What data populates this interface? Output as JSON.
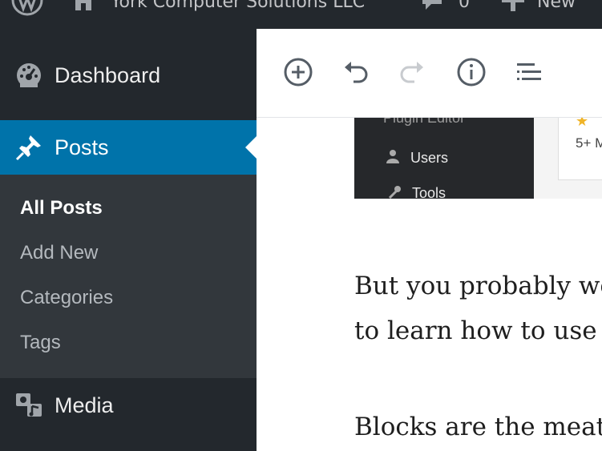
{
  "admin_bar": {
    "site_name": "York Computer Solutions LLC",
    "comments_count": "0",
    "new_label": "New",
    "icons": [
      "wordpress-logo-icon",
      "home-icon",
      "comment-icon",
      "plus-icon"
    ]
  },
  "sidebar": {
    "dashboard_label": "Dashboard",
    "posts_label": "Posts",
    "posts_submenu": [
      "All Posts",
      "Add New",
      "Categories",
      "Tags"
    ],
    "current_submenu": "All Posts",
    "media_label": "Media",
    "colors": {
      "background": "#23282d",
      "active": "#0073aa",
      "submenu_bg": "#32373c"
    }
  },
  "toolbar": {
    "buttons": [
      "add-block-icon",
      "undo-icon",
      "redo-icon",
      "info-icon",
      "outline-icon"
    ]
  },
  "content": {
    "screenshot_menu_items": [
      "Plugin Editor",
      "Users",
      "Tools"
    ],
    "screenshot_panel_text": "5+ M",
    "paragraph_1_line_1": "But you probably we",
    "paragraph_1_line_2": "to learn how to use (",
    "paragraph_2_line_1": "Blocks are the meat "
  }
}
